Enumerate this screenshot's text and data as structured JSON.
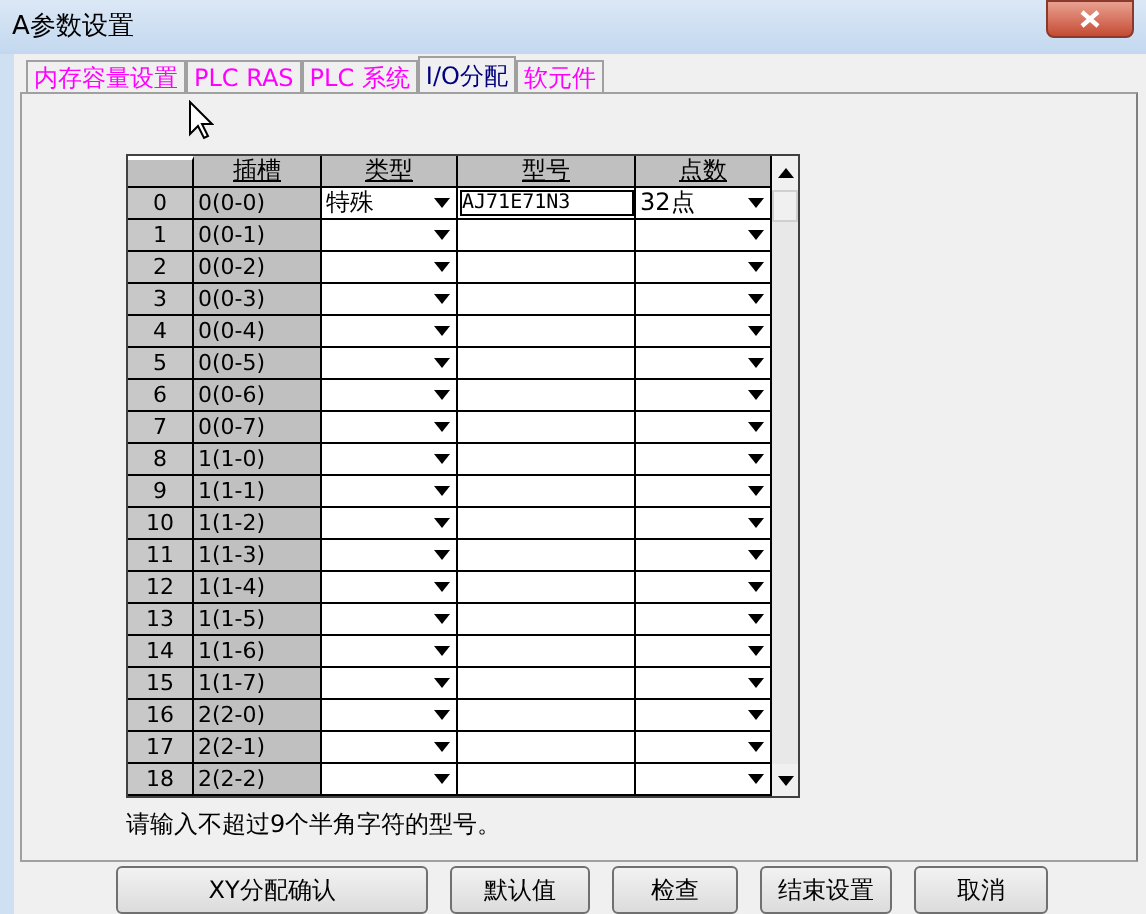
{
  "window": {
    "title": "A参数设置"
  },
  "tabs": [
    {
      "label": "内存容量设置",
      "selected": false
    },
    {
      "label": "PLC RAS",
      "selected": false
    },
    {
      "label": "PLC 系统",
      "selected": false
    },
    {
      "label": "I/O分配",
      "selected": true
    },
    {
      "label": "软元件",
      "selected": false
    }
  ],
  "table": {
    "columns": [
      "插槽",
      "类型",
      "型号",
      "点数"
    ],
    "rows": [
      {
        "index": "0",
        "slot": "0(0-0)",
        "type": "特殊",
        "model": "AJ71E71N3",
        "points": "32点",
        "editing": true
      },
      {
        "index": "1",
        "slot": "0(0-1)",
        "editing": false
      },
      {
        "index": "2",
        "slot": "0(0-2)",
        "editing": false
      },
      {
        "index": "3",
        "slot": "0(0-3)",
        "editing": false
      },
      {
        "index": "4",
        "slot": "0(0-4)",
        "editing": false
      },
      {
        "index": "5",
        "slot": "0(0-5)",
        "editing": false
      },
      {
        "index": "6",
        "slot": "0(0-6)",
        "editing": false
      },
      {
        "index": "7",
        "slot": "0(0-7)",
        "editing": false
      },
      {
        "index": "8",
        "slot": "1(1-0)",
        "editing": false
      },
      {
        "index": "9",
        "slot": "1(1-1)",
        "editing": false
      },
      {
        "index": "10",
        "slot": "1(1-2)",
        "editing": false
      },
      {
        "index": "11",
        "slot": "1(1-3)",
        "editing": false
      },
      {
        "index": "12",
        "slot": "1(1-4)",
        "editing": false
      },
      {
        "index": "13",
        "slot": "1(1-5)",
        "editing": false
      },
      {
        "index": "14",
        "slot": "1(1-6)",
        "editing": false
      },
      {
        "index": "15",
        "slot": "1(1-7)",
        "editing": false
      },
      {
        "index": "16",
        "slot": "2(2-0)",
        "editing": false
      },
      {
        "index": "17",
        "slot": "2(2-1)",
        "editing": false
      },
      {
        "index": "18",
        "slot": "2(2-2)",
        "editing": false
      }
    ]
  },
  "hint": "请输入不超过9个半角字符的型号。",
  "buttons": [
    "XY分配确认",
    "默认值",
    "检查",
    "结束设置",
    "取消"
  ]
}
